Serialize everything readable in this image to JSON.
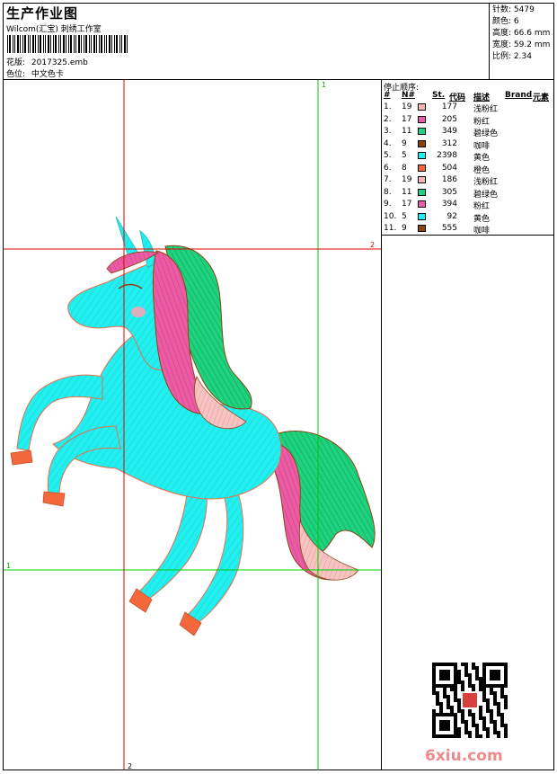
{
  "header": {
    "title": "生产作业图",
    "studio": "Wilcom(汇宝) 刺绣工作室",
    "design_label": "花版:",
    "design_file": "2017325.emb",
    "color_label": "色位:",
    "color_card": "中文色卡"
  },
  "stats": [
    {
      "label": "针数:",
      "value": "5479"
    },
    {
      "label": "颜色:",
      "value": "6"
    },
    {
      "label": "高度:",
      "value": "66.6 mm"
    },
    {
      "label": "宽度:",
      "value": "59.2 mm"
    },
    {
      "label": "比例:",
      "value": "2.34"
    }
  ],
  "stop_sequence": {
    "title": "停止顺序:",
    "columns": [
      "#",
      "N#",
      "St.",
      "代码",
      "描述",
      "Brand",
      "元素"
    ],
    "rows": [
      {
        "idx": "1.",
        "n": "19",
        "color": "#f4b6b4",
        "st": "177",
        "desc": "浅粉红"
      },
      {
        "idx": "2.",
        "n": "17",
        "color": "#ec5ca4",
        "st": "205",
        "desc": "粉红"
      },
      {
        "idx": "3.",
        "n": "11",
        "color": "#1ed27e",
        "st": "349",
        "desc": "碧绿色"
      },
      {
        "idx": "4.",
        "n": "9",
        "color": "#8b4513",
        "st": "312",
        "desc": "咖啡"
      },
      {
        "idx": "5.",
        "n": "5",
        "color": "#22f0f0",
        "st": "2398",
        "desc": "黄色"
      },
      {
        "idx": "6.",
        "n": "8",
        "color": "#f4683c",
        "st": "504",
        "desc": "橙色"
      },
      {
        "idx": "7.",
        "n": "19",
        "color": "#f4b6b4",
        "st": "186",
        "desc": "浅粉红"
      },
      {
        "idx": "8.",
        "n": "11",
        "color": "#1ed27e",
        "st": "305",
        "desc": "碧绿色"
      },
      {
        "idx": "9.",
        "n": "17",
        "color": "#ec5ca4",
        "st": "394",
        "desc": "粉红"
      },
      {
        "idx": "10.",
        "n": "5",
        "color": "#22f0f0",
        "st": "92",
        "desc": "黄色"
      },
      {
        "idx": "11.",
        "n": "9",
        "color": "#8b4513",
        "st": "555",
        "desc": "咖啡"
      }
    ]
  },
  "guides": {
    "green_v": "1",
    "red_h": "2",
    "green_h": "1",
    "red_v": "2",
    "red_color": "#e00000",
    "green_color": "#00cc00"
  },
  "watermark": {
    "site_prefix": "6",
    "site_rest": "xiu.com"
  }
}
